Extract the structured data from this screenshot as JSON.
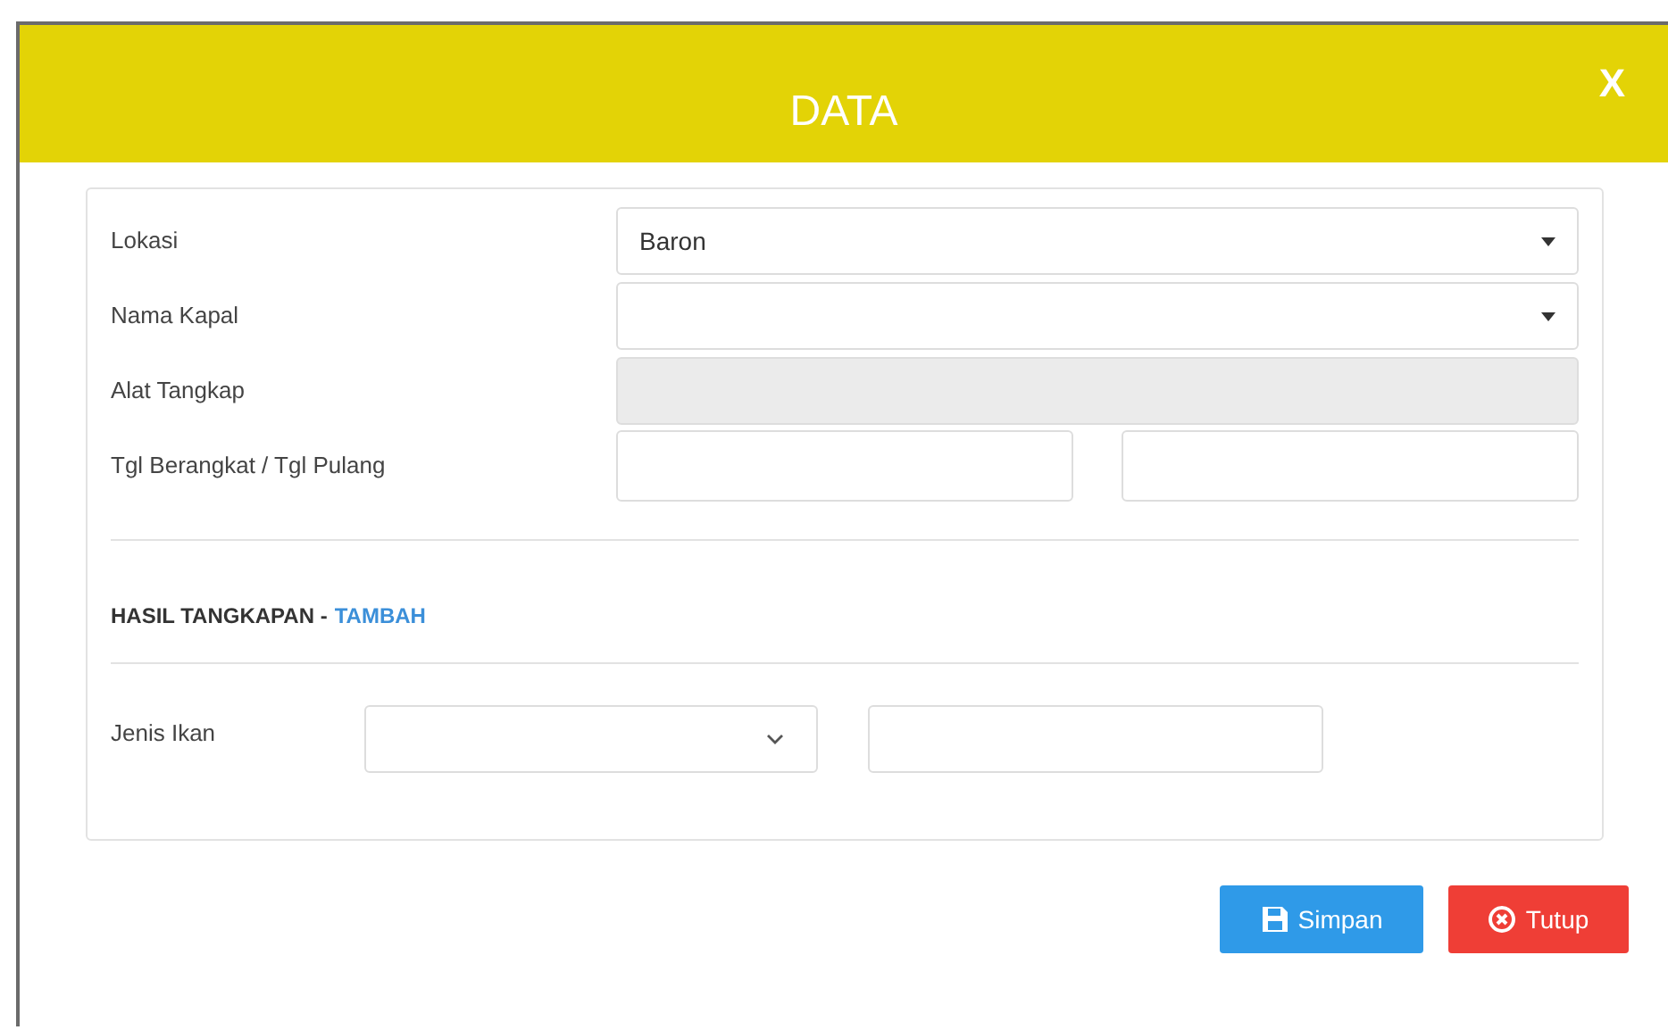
{
  "dialog": {
    "title": "DATA",
    "close": "X"
  },
  "fields": [
    {
      "label": "Lokasi",
      "kind": "select",
      "value": "Baron"
    },
    {
      "label": "Nama Kapal",
      "kind": "select"
    },
    {
      "label": "Alat Tangkap",
      "kind": "input",
      "disabled": true
    },
    {
      "label": "Tgl Berangkat / Tgl Pulang",
      "kind": "pair"
    }
  ],
  "section": {
    "title": "HASIL TANGKAPAN -",
    "link": "TAMBAH"
  },
  "catch_row": {
    "label": "Jenis Ikan"
  },
  "buttons": [
    {
      "label": "Simpan",
      "kind": "save"
    },
    {
      "label": "Tutup",
      "kind": "close"
    }
  ]
}
